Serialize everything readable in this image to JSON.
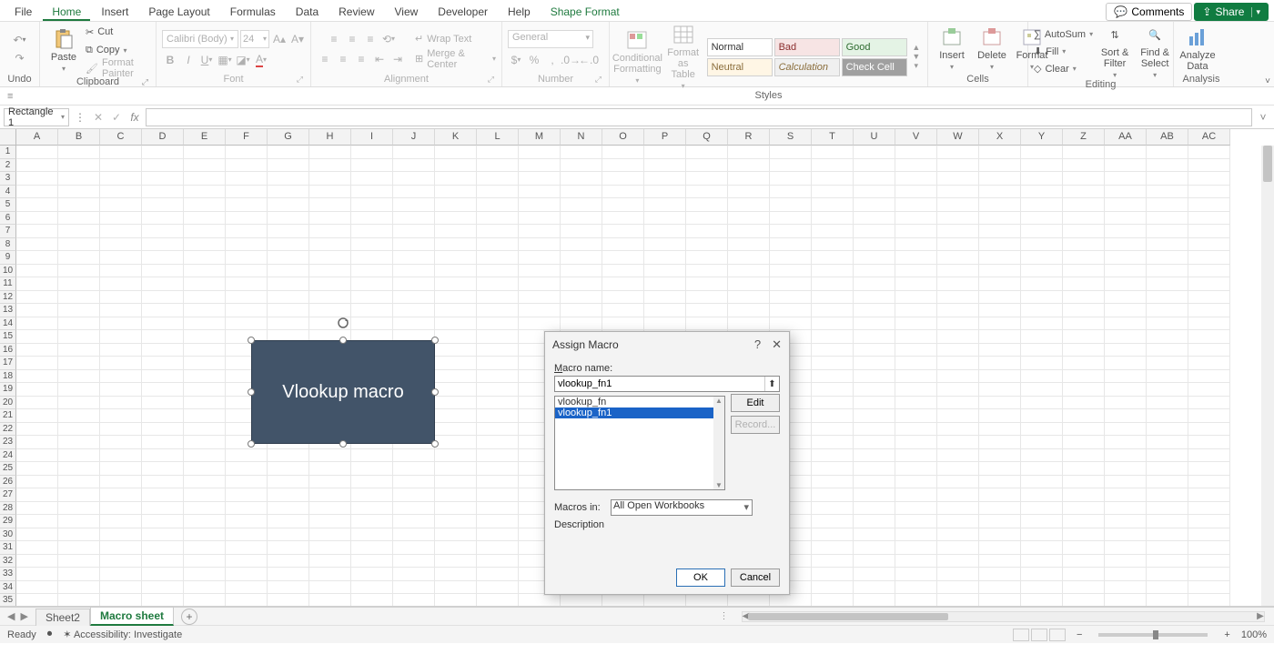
{
  "tabs": {
    "file": "File",
    "home": "Home",
    "insert": "Insert",
    "page_layout": "Page Layout",
    "formulas": "Formulas",
    "data": "Data",
    "review": "Review",
    "view": "View",
    "developer": "Developer",
    "help": "Help",
    "shape_format": "Shape Format"
  },
  "titlebar": {
    "comments": "Comments",
    "share": "Share"
  },
  "ribbon": {
    "undo": {
      "label": "Undo"
    },
    "clipboard": {
      "paste": "Paste",
      "cut": "Cut",
      "copy": "Copy",
      "format_painter": "Format Painter",
      "label": "Clipboard"
    },
    "font": {
      "name": "Calibri (Body)",
      "size": "24",
      "label": "Font"
    },
    "alignment": {
      "wrap": "Wrap Text",
      "merge": "Merge & Center",
      "label": "Alignment"
    },
    "number": {
      "format": "General",
      "label": "Number"
    },
    "styles": {
      "cond": "Conditional\nFormatting",
      "table": "Format as\nTable",
      "normal": "Normal",
      "bad": "Bad",
      "good": "Good",
      "neutral": "Neutral",
      "calculation": "Calculation",
      "check": "Check Cell",
      "label": "Styles"
    },
    "cells": {
      "insert": "Insert",
      "delete": "Delete",
      "format": "Format",
      "label": "Cells"
    },
    "editing": {
      "autosum": "AutoSum",
      "fill": "Fill",
      "clear": "Clear",
      "sort": "Sort &\nFilter",
      "find": "Find &\nSelect",
      "label": "Editing"
    },
    "analysis": {
      "analyze": "Analyze\nData",
      "label": "Analysis"
    }
  },
  "formula_bar": {
    "name_box": "Rectangle 1",
    "fx": "fx"
  },
  "columns": [
    "A",
    "B",
    "C",
    "D",
    "E",
    "F",
    "G",
    "H",
    "I",
    "J",
    "K",
    "L",
    "M",
    "N",
    "O",
    "P",
    "Q",
    "R",
    "S",
    "T",
    "U",
    "V",
    "W",
    "X",
    "Y",
    "Z",
    "AA",
    "AB",
    "AC"
  ],
  "row_count": 35,
  "shape": {
    "text": "Vlookup macro"
  },
  "dialog": {
    "title": "Assign Macro",
    "macro_name_label": "Macro name:",
    "macro_name_value": "vlookup_fn1",
    "macros": [
      "vlookup_fn",
      "vlookup_fn1"
    ],
    "selected_macro_index": 1,
    "macros_in_label": "Macros in:",
    "macros_in_value": "All Open Workbooks",
    "description_label": "Description",
    "edit": "Edit",
    "record": "Record...",
    "ok": "OK",
    "cancel": "Cancel"
  },
  "sheets": {
    "nav_sheets": [
      "Sheet2",
      "Macro sheet"
    ],
    "active_index": 1
  },
  "status": {
    "ready": "Ready",
    "accessibility": "Accessibility: Investigate",
    "zoom": "100%"
  }
}
